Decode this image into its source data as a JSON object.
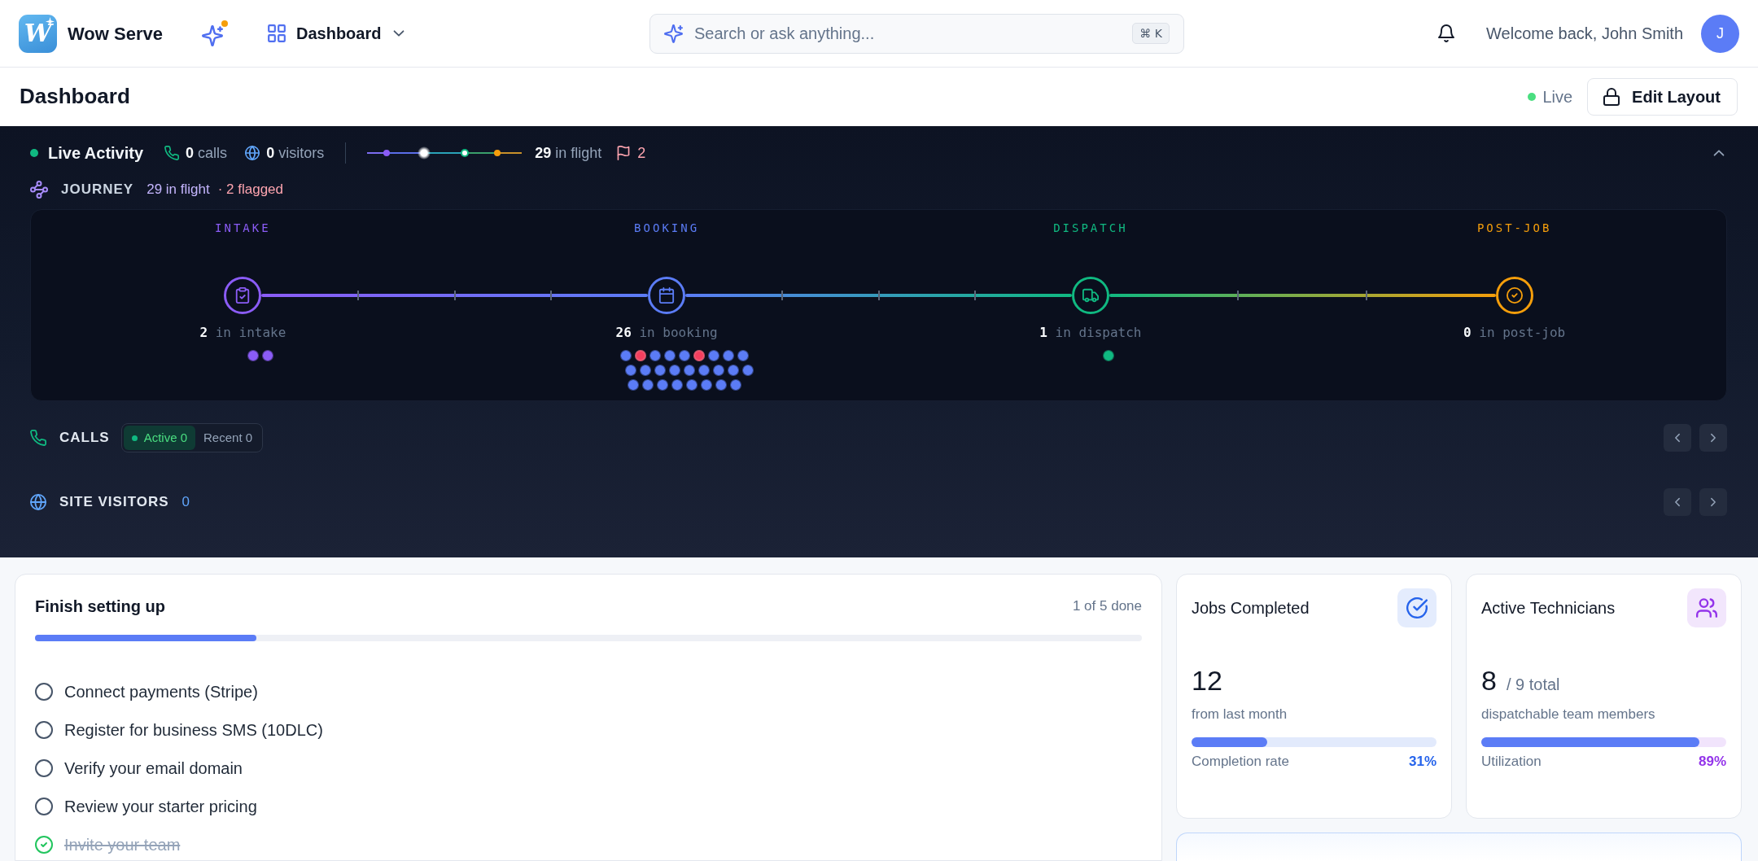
{
  "navbar": {
    "logo_letter": "W",
    "brand": "Wow Serve",
    "menu": "Dashboard",
    "search": {
      "placeholder": "Search or ask anything...",
      "shortcut": "⌘ K"
    },
    "welcome": "Welcome back, John Smith",
    "avatar": "J"
  },
  "page_header": {
    "title": "Dashboard",
    "status": "Live",
    "edit_button": "Edit Layout"
  },
  "live_activity": {
    "title": "Live Activity",
    "expanded": true,
    "calls": "**0** calls",
    "visitors": "**0** visitors",
    "in_flight": "**29** in flight",
    "flagged": "2",
    "journey": {
      "title": "JOURNEY",
      "in_flight": "29 in flight",
      "flagged": "· 2 flagged",
      "stages": [
        {
          "label": "INTAKE",
          "kind": "intake",
          "color": "#8b5cf6",
          "count": "**2** in intake",
          "jobs": [
            {
              "flagged": false
            },
            {
              "flagged": false
            }
          ]
        },
        {
          "label": "BOOKING",
          "kind": "booking",
          "color": "#5b7cf6",
          "count": "**26** in booking",
          "jobs": [
            {
              "flagged": false
            },
            {
              "flagged": true
            },
            {
              "flagged": false
            },
            {
              "flagged": false
            },
            {
              "flagged": false
            },
            {
              "flagged": true
            },
            {
              "flagged": false
            },
            {
              "flagged": false
            },
            {
              "flagged": false
            },
            {
              "flagged": false
            },
            {
              "flagged": false
            },
            {
              "flagged": false
            },
            {
              "flagged": false
            },
            {
              "flagged": false
            },
            {
              "flagged": false
            },
            {
              "flagged": false
            },
            {
              "flagged": false
            },
            {
              "flagged": false
            },
            {
              "flagged": false
            },
            {
              "flagged": false
            },
            {
              "flagged": false
            },
            {
              "flagged": false
            },
            {
              "flagged": false
            },
            {
              "flagged": false
            },
            {
              "flagged": false
            },
            {
              "flagged": false
            }
          ]
        },
        {
          "label": "DISPATCH",
          "kind": "dispatch",
          "color": "#10b981",
          "count": "**1** in dispatch",
          "jobs": [
            {
              "flagged": false
            }
          ]
        },
        {
          "label": "POST-JOB",
          "kind": "post_job",
          "color": "#f59e0b",
          "count": "**0** in post-job"
        }
      ]
    },
    "calls_panel": {
      "title": "CALLS",
      "tabs": [
        {
          "label": "Active 0",
          "selected": true
        },
        {
          "label": "Recent 0",
          "selected": false
        }
      ]
    },
    "site_visitors": {
      "title": "SITE VISITORS",
      "count": "0"
    }
  },
  "setup": {
    "title": "Finish setting up",
    "progress_text": "1 of 5 done",
    "level": 0.2,
    "items": [
      {
        "label": "Connect payments (Stripe)",
        "checked": false
      },
      {
        "label": "Register for business SMS (10DLC)",
        "checked": false
      },
      {
        "label": "Verify your email domain",
        "checked": false
      },
      {
        "label": "Review your starter pricing",
        "checked": false
      },
      {
        "label": "Invite your team",
        "checked": true
      }
    ]
  },
  "stats": [
    {
      "title": "Jobs Completed",
      "kind": "jobs",
      "color": "#2563eb",
      "value": "12",
      "subtext": "from last month",
      "bar_label": "Completion rate",
      "percent": "31%",
      "level": 0.31
    },
    {
      "title": "Active Technicians",
      "kind": "technicians",
      "color": "#9333ea",
      "value": "8",
      "value_suffix": "/ 9 total",
      "subtext": "dispatchable team members",
      "bar_label": "Utilization",
      "percent": "89%",
      "level": 0.89
    }
  ]
}
